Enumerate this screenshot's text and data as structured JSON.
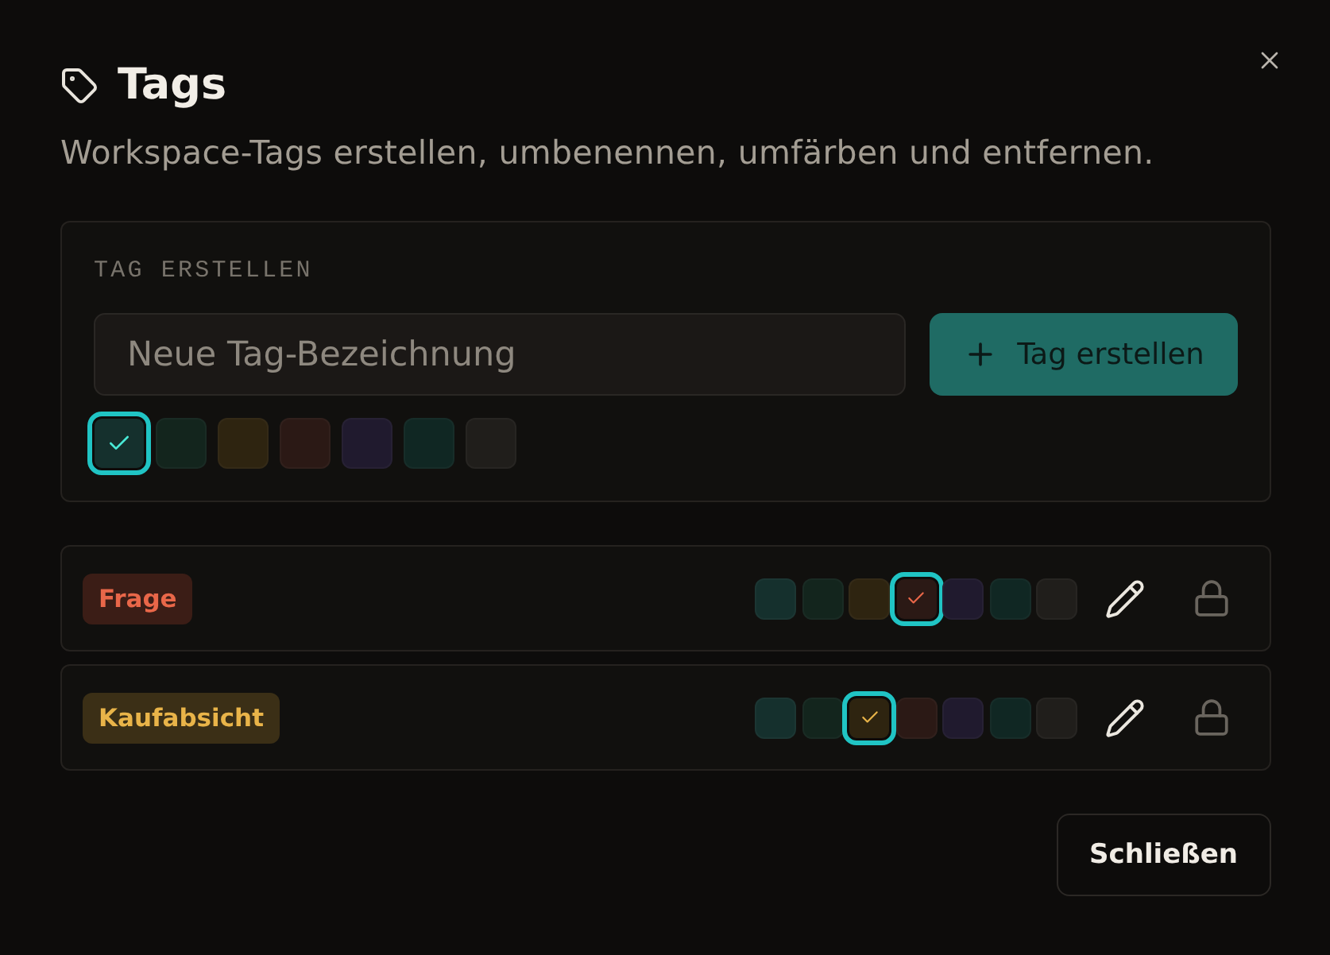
{
  "dialog": {
    "title": "Tags",
    "subtitle": "Workspace-Tags erstellen, umbenennen, umfärben und entfernen."
  },
  "create": {
    "label": "TAG ERSTELLEN",
    "input": {
      "placeholder": "Neue Tag-Bezeichnung"
    },
    "button": "Tag erstellen",
    "swatches": [
      {
        "color": "#15302d",
        "selected": true
      },
      {
        "color": "#13251d",
        "selected": false
      },
      {
        "color": "#2e2410",
        "selected": false
      },
      {
        "color": "#2b1915",
        "selected": false
      },
      {
        "color": "#201a2e",
        "selected": false
      },
      {
        "color": "#102723",
        "selected": false
      },
      {
        "color": "#201e1b",
        "selected": false
      }
    ]
  },
  "tags": [
    {
      "name": "Frage",
      "swatches": [
        {
          "color": "#15302d",
          "selected": false
        },
        {
          "color": "#13251d",
          "selected": false
        },
        {
          "color": "#2e2410",
          "selected": false
        },
        {
          "color": "#2b1915",
          "selected": true
        },
        {
          "color": "#201a2e",
          "selected": false
        },
        {
          "color": "#102723",
          "selected": false
        },
        {
          "color": "#201e1b",
          "selected": false
        }
      ]
    },
    {
      "name": "Kaufabsicht",
      "swatches": [
        {
          "color": "#15302d",
          "selected": false
        },
        {
          "color": "#13251d",
          "selected": false
        },
        {
          "color": "#2e2410",
          "selected": true
        },
        {
          "color": "#2b1915",
          "selected": false
        },
        {
          "color": "#201a2e",
          "selected": false
        },
        {
          "color": "#102723",
          "selected": false
        },
        {
          "color": "#201e1b",
          "selected": false
        }
      ]
    }
  ],
  "footer": {
    "button": "Schließen"
  }
}
